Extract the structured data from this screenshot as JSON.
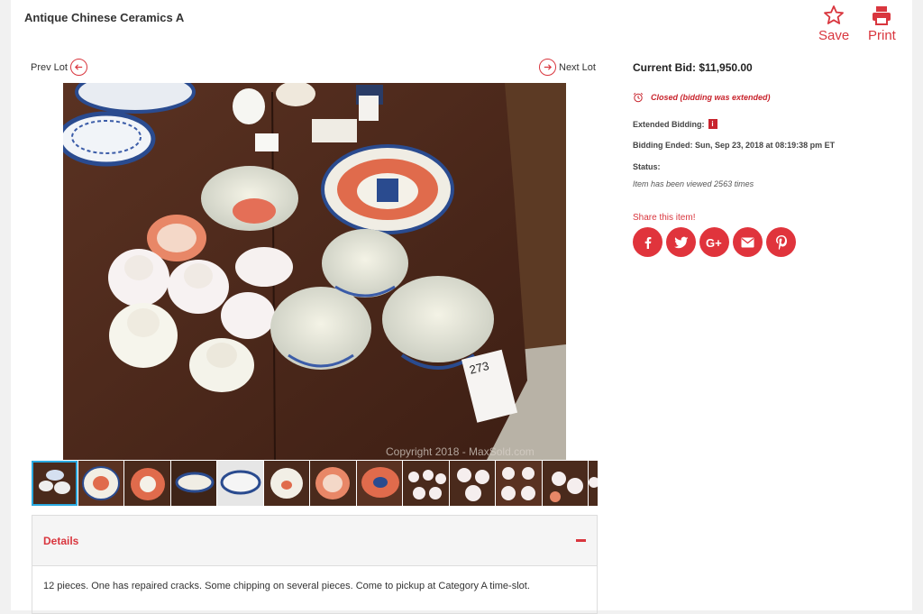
{
  "header": {
    "title": "Antique Chinese Ceramics A",
    "save_label": "Save",
    "print_label": "Print"
  },
  "gallery": {
    "prev_label": "Prev Lot",
    "next_label": "Next Lot",
    "watermark": "Copyright 2018 - MaxSold.com",
    "tag_number": "273",
    "thumbnail_count": 13,
    "active_thumbnail": 1
  },
  "details": {
    "title": "Details",
    "text": "12 pieces. One has repaired cracks. Some chipping on several pieces. Come to pickup at Category A time-slot."
  },
  "bid_panel": {
    "current_bid": "Current Bid: $11,950.00",
    "closed_text": "Closed (bidding was extended)",
    "extended_label": "Extended Bidding:",
    "info_badge": "i",
    "ended_label": "Bidding Ended:",
    "ended_value": "Sun, Sep 23, 2018 at 08:19:38 pm ET",
    "status_label": "Status:",
    "views_text": "Item has been viewed 2563 times",
    "share_label": "Share this item!",
    "share_buttons": [
      "facebook-icon",
      "twitter-icon",
      "google-plus-icon",
      "email-icon",
      "pinterest-icon"
    ]
  },
  "colors": {
    "accent": "#d9363e",
    "share_bg": "#e0343c",
    "active_thumb": "#2aa9e0"
  }
}
